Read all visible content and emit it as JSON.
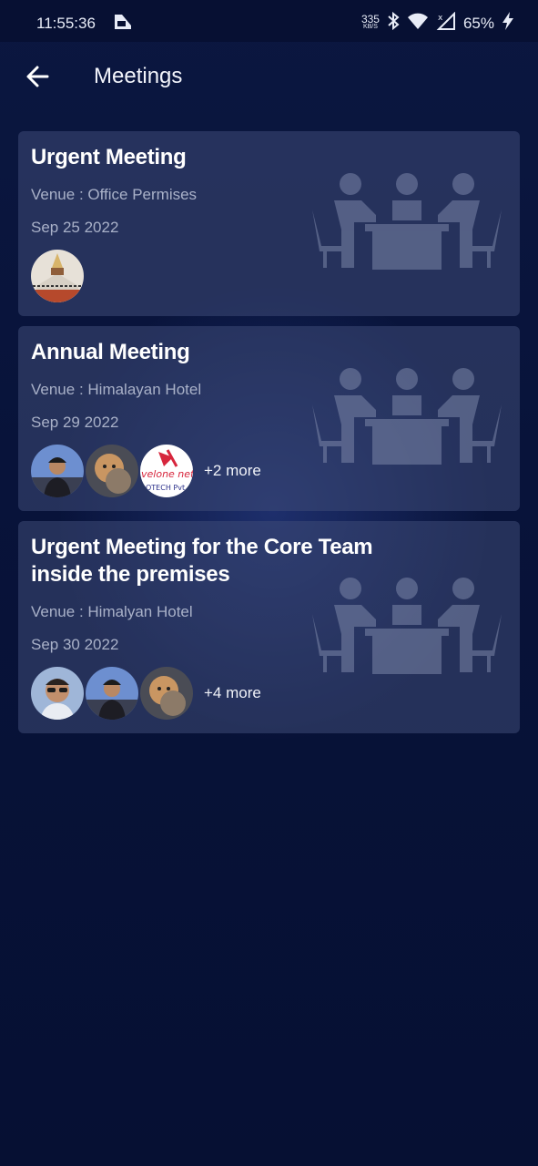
{
  "status_bar": {
    "time": "11:55:36",
    "net_speed_value": "335",
    "net_speed_unit": "KB/S",
    "battery": "65%"
  },
  "header": {
    "title": "Meetings"
  },
  "meetings": [
    {
      "title": "Urgent Meeting",
      "venue": "Venue : Office Permises",
      "date": "Sep 25 2022",
      "more": ""
    },
    {
      "title": "Annual Meeting",
      "venue": "Venue : Himalayan Hotel",
      "date": "Sep 29 2022",
      "more": "+2 more"
    },
    {
      "title": "Urgent Meeting for the Core Team inside the premises",
      "venue": "Venue : Himalyan Hotel",
      "date": "Sep 30 2022",
      "more": "+4 more"
    }
  ]
}
